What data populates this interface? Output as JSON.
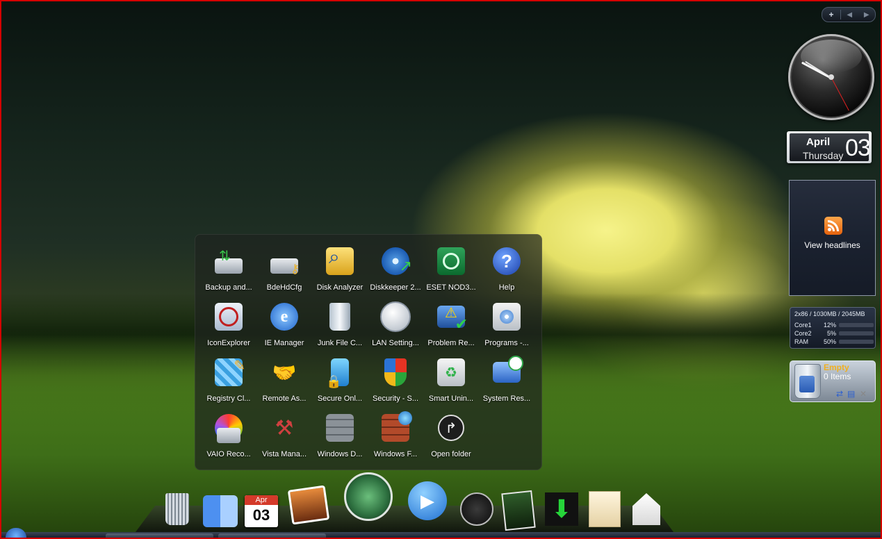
{
  "gadget_toolbar": {
    "add": "+",
    "prev": "◀",
    "next": "▶"
  },
  "calendar": {
    "month": "April",
    "weekday": "Thursday",
    "day": "03"
  },
  "feed": {
    "label": "View headlines"
  },
  "cpu_meter": {
    "header": "2x86 / 1030MB / 2045MB",
    "rows": [
      {
        "name": "Core1",
        "value": "12%",
        "fraction": 0.12
      },
      {
        "name": "Core2",
        "value": "5%",
        "fraction": 0.05
      },
      {
        "name": "RAM",
        "value": "50%",
        "fraction": 0.5
      }
    ]
  },
  "recycle_bin": {
    "status": "Empty",
    "count": "0 Items"
  },
  "stack": {
    "items": [
      {
        "label": "Backup and...",
        "icon": "backup-icon"
      },
      {
        "label": "BdeHdCfg",
        "icon": "drive-key-icon"
      },
      {
        "label": "Disk Analyzer",
        "icon": "magnifier-icon"
      },
      {
        "label": "Diskkeeper 2...",
        "icon": "defrag-disc-icon"
      },
      {
        "label": "ESET NOD3...",
        "icon": "eset-icon"
      },
      {
        "label": "Help",
        "icon": "help-icon"
      },
      {
        "label": "IconExplorer",
        "icon": "icon-explorer-icon"
      },
      {
        "label": "IE Manager",
        "icon": "ie-manager-icon"
      },
      {
        "label": "Junk File C...",
        "icon": "recycle-bin-icon"
      },
      {
        "label": "LAN Setting...",
        "icon": "globe-icon"
      },
      {
        "label": "Problem Re...",
        "icon": "warning-monitor-icon"
      },
      {
        "label": "Programs -...",
        "icon": "programs-icon"
      },
      {
        "label": "Registry Cl...",
        "icon": "registry-icon"
      },
      {
        "label": "Remote As...",
        "icon": "remote-assist-icon"
      },
      {
        "label": "Secure Onl...",
        "icon": "secure-online-icon"
      },
      {
        "label": "Security - S...",
        "icon": "shield-icon"
      },
      {
        "label": "Smart Unin...",
        "icon": "uninstall-icon"
      },
      {
        "label": "System Res...",
        "icon": "system-restore-icon"
      },
      {
        "label": "VAIO Reco...",
        "icon": "vaio-recovery-icon"
      },
      {
        "label": "Vista Mana...",
        "icon": "tools-icon"
      },
      {
        "label": "Windows D...",
        "icon": "wall-icon"
      },
      {
        "label": "Windows F...",
        "icon": "firewall-icon"
      },
      {
        "label": "Open folder",
        "icon": "open-folder-arrow-icon"
      }
    ]
  },
  "dock": {
    "items": [
      {
        "name": "trash-icon"
      },
      {
        "name": "finder-icon"
      },
      {
        "name": "ical-icon",
        "month": "Apr",
        "day": "03"
      },
      {
        "name": "iphoto-icon"
      },
      {
        "name": "time-machine-icon"
      },
      {
        "name": "media-player-icon"
      },
      {
        "name": "dashboard-icon"
      },
      {
        "name": "photo-stack-icon"
      },
      {
        "name": "download-icon"
      },
      {
        "name": "notes-icon"
      },
      {
        "name": "home-icon"
      }
    ]
  },
  "colors": {
    "frame_border": "#d40000",
    "recycle_status": "#f0b020",
    "rss_orange": "#ff8a1e"
  }
}
